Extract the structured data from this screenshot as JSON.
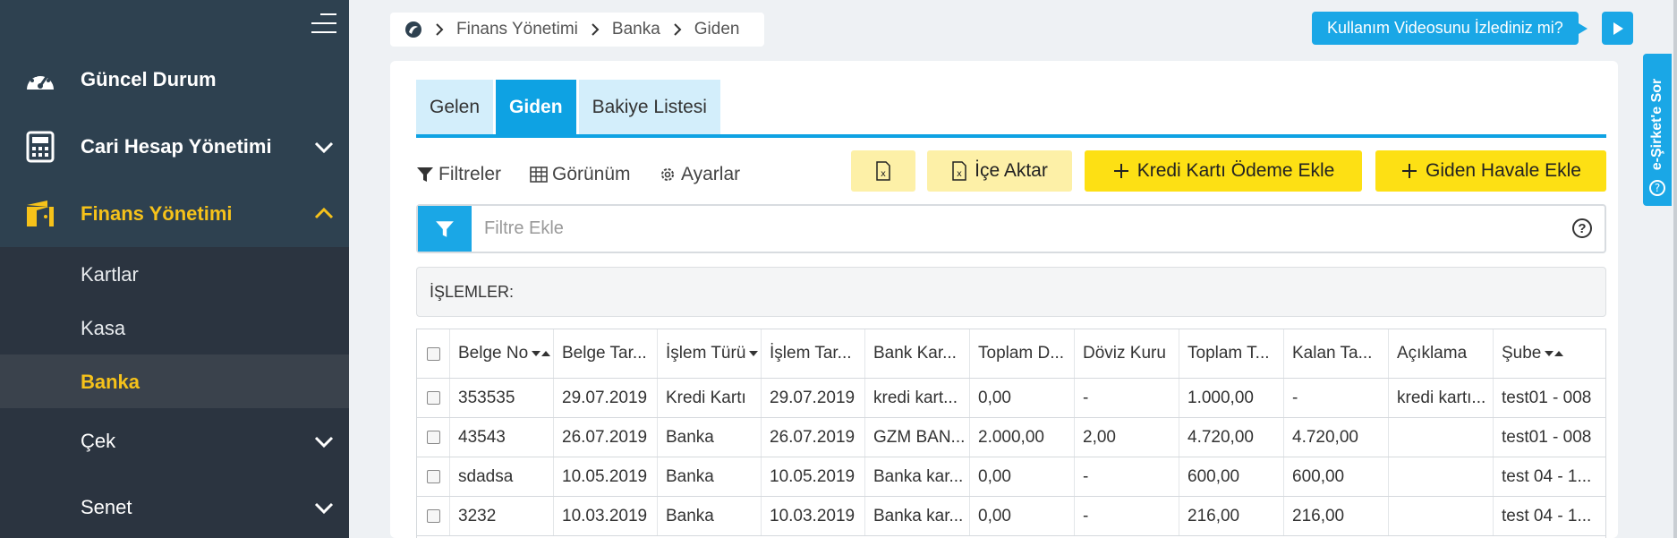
{
  "sidebar": {
    "items": [
      {
        "label": "Güncel Durum",
        "icon": "dashboard-gauge-icon"
      },
      {
        "label": "Cari Hesap Yönetimi",
        "icon": "calculator-icon"
      },
      {
        "label": "Finans Yönetimi",
        "icon": "wallet-icon"
      }
    ],
    "subitems": [
      {
        "label": "Kartlar"
      },
      {
        "label": "Kasa"
      },
      {
        "label": "Banka"
      }
    ],
    "more_items": [
      {
        "label": "Çek"
      },
      {
        "label": "Senet"
      }
    ],
    "colors": {
      "accent": "#f6c21a",
      "bg": "#2b3440",
      "top_bg": "#2e4150"
    }
  },
  "breadcrumb": {
    "items": [
      "Finans Yönetimi",
      "Banka",
      "Giden"
    ]
  },
  "video_prompt": "Kullanım Videosunu İzlediniz mi?",
  "side_tab": "e-Şirket'e Sor",
  "tabs": [
    {
      "label": "Gelen"
    },
    {
      "label": "Giden"
    },
    {
      "label": "Bakiye Listesi"
    }
  ],
  "toolbar": {
    "filters": "Filtreler",
    "view": "Görünüm",
    "settings": "Ayarlar",
    "import": "İçe Aktar",
    "add_card_payment": "Kredi Kartı Ödeme Ekle",
    "add_transfer": "Giden Havale Ekle"
  },
  "filter": {
    "placeholder": "Filtre Ekle",
    "help": "?"
  },
  "section_title": "İŞLEMLER:",
  "table": {
    "columns": [
      "Belge No",
      "Belge Tar...",
      "İşlem Türü",
      "İşlem Tar...",
      "Bank Kar...",
      "Toplam D...",
      "Döviz Kuru",
      "Toplam T...",
      "Kalan Ta...",
      "Açıklama",
      "Şube"
    ],
    "rows": [
      [
        "353535",
        "29.07.2019",
        "Kredi Kartı",
        "29.07.2019",
        "kredi kart...",
        "0,00",
        "-",
        "1.000,00",
        "-",
        "kredi kartı...",
        "test01 - 008"
      ],
      [
        "43543",
        "26.07.2019",
        "Banka",
        "26.07.2019",
        "GZM BAN...",
        "2.000,00",
        "2,00",
        "4.720,00",
        "4.720,00",
        "",
        "test01 - 008"
      ],
      [
        "sdadsa",
        "10.05.2019",
        "Banka",
        "10.05.2019",
        "Banka kar...",
        "0,00",
        "-",
        "600,00",
        "600,00",
        "",
        "test 04 - 1..."
      ],
      [
        "3232",
        "10.03.2019",
        "Banka",
        "10.03.2019",
        "Banka kar...",
        "0,00",
        "-",
        "216,00",
        "216,00",
        "",
        "test 04 - 1..."
      ]
    ]
  },
  "colors": {
    "primary": "#0ea2e3",
    "yellow": "#fde014",
    "soft_yellow": "#fdf0a7"
  }
}
